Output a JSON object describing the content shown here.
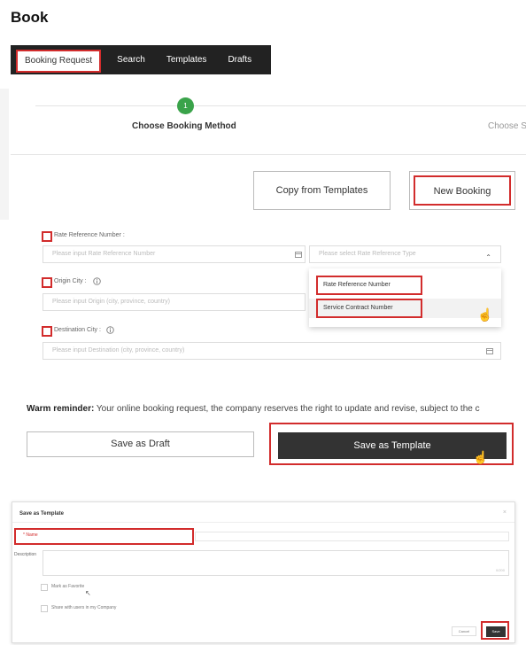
{
  "page": {
    "title": "Book"
  },
  "tabs": [
    {
      "label": "Booking Request",
      "active": true
    },
    {
      "label": "Search"
    },
    {
      "label": "Templates"
    },
    {
      "label": "Drafts"
    }
  ],
  "stepper": {
    "step_number": "1",
    "step1_label": "Choose Booking Method",
    "step2_label": "Choose S"
  },
  "method": {
    "copy_label": "Copy from Templates",
    "new_label": "New Booking"
  },
  "form": {
    "rate_ref_label": "Rate Reference Number :",
    "rate_ref_placeholder": "Please input Rate Reference Number",
    "rate_type_placeholder": "Please select Rate Reference Type",
    "rate_type_options": [
      "Rate Reference Number",
      "Service Contract Number"
    ],
    "origin_label": "Origin City :",
    "origin_placeholder": "Please input Origin (city, province, country)",
    "destination_label": "Destination City :",
    "destination_placeholder": "Please input Destination (city, province, country)"
  },
  "reminder": {
    "bold": "Warm reminder:",
    "text": " Your online booking request, the company reserves the right to update and revise, subject to the c"
  },
  "actions": {
    "save_draft": "Save as Draft",
    "save_template": "Save as Template"
  },
  "modal": {
    "title": "Save as Template",
    "close": "×",
    "name_label": "* Name",
    "description_label": "Description",
    "desc_count": "0/200",
    "favorite_label": "Mark as Favorite",
    "share_label": "Share with users in my Company",
    "cancel": "Cancel",
    "save": "Save"
  },
  "colors": {
    "accent_red": "#d22c2c",
    "step_green": "#3aa34a",
    "dark_button": "#333333"
  }
}
